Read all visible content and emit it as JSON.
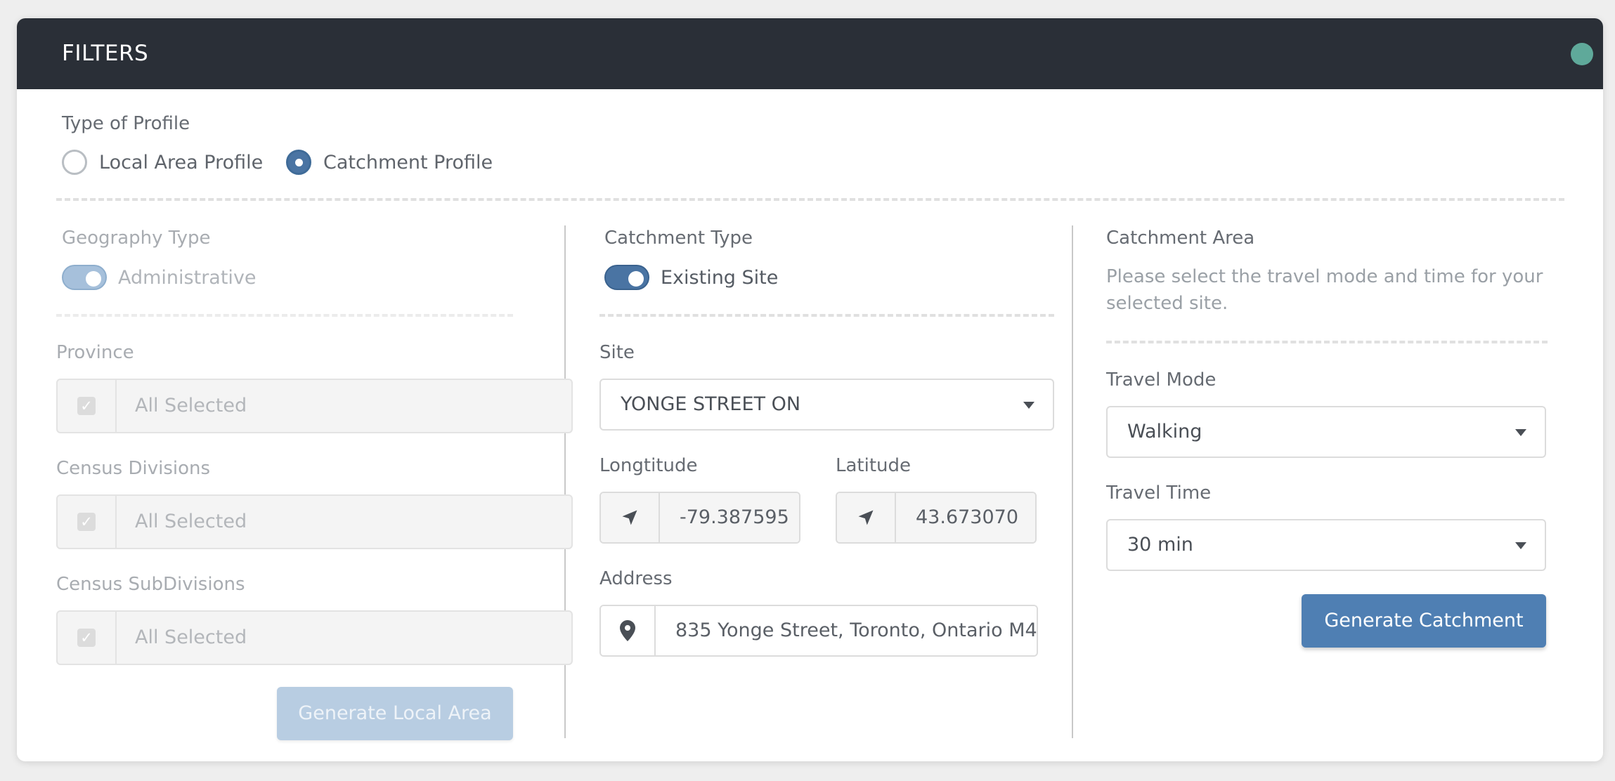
{
  "header": {
    "title": "FILTERS"
  },
  "profile": {
    "label": "Type of Profile",
    "options": [
      "Local Area Profile",
      "Catchment Profile"
    ],
    "selected": "Catchment Profile"
  },
  "left": {
    "geo_label": "Geography Type",
    "geo_toggle": "Administrative",
    "province_label": "Province",
    "province_value": "All Selected",
    "divisions_label": "Census Divisions",
    "divisions_value": "All Selected",
    "subdivisions_label": "Census SubDivisions",
    "subdivisions_value": "All Selected",
    "button": "Generate Local Area"
  },
  "middle": {
    "type_label": "Catchment Type",
    "type_toggle": "Existing Site",
    "site_label": "Site",
    "site_value": "YONGE STREET ON",
    "lon_label": "Longtitude",
    "lon_value": "-79.387595",
    "lat_label": "Latitude",
    "lat_value": "43.673070",
    "address_label": "Address",
    "address_value": "835 Yonge Street, Toronto, Ontario M4"
  },
  "right": {
    "area_label": "Catchment Area",
    "help": "Please select the travel mode and time for your selected site.",
    "mode_label": "Travel Mode",
    "mode_value": "Walking",
    "time_label": "Travel Time",
    "time_value": "30 min",
    "button": "Generate Catchment"
  },
  "colors": {
    "header": "#2a2f37",
    "accent": "#4f7fb3",
    "status": "#5fa99a"
  }
}
